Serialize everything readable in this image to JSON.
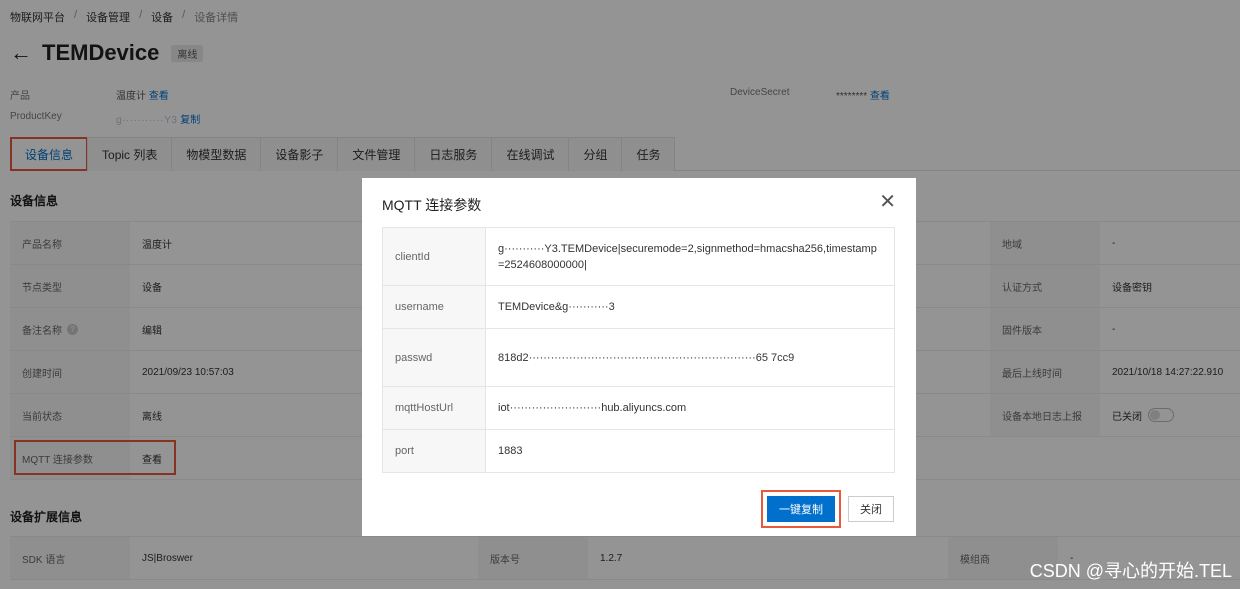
{
  "breadcrumb": [
    "物联网平台",
    "设备管理",
    "设备",
    "设备详情"
  ],
  "header": {
    "title": "TEMDevice",
    "status_badge": "离线"
  },
  "meta": {
    "product_label": "产品",
    "product_value": "温度计",
    "product_link": "查看",
    "productkey_label": "ProductKey",
    "productkey_value": "g···········Y3",
    "productkey_link": "复制",
    "secret_label": "DeviceSecret",
    "secret_value": "********",
    "secret_link": "查看"
  },
  "tabs": [
    "设备信息",
    "Topic 列表",
    "物模型数据",
    "设备影子",
    "文件管理",
    "日志服务",
    "在线调试",
    "分组",
    "任务"
  ],
  "info_section": {
    "title": "设备信息",
    "rows": [
      {
        "label": "产品名称",
        "value": "温度计",
        "label2": "地域",
        "value2": "-"
      },
      {
        "label": "节点类型",
        "value": "设备",
        "label2": "认证方式",
        "value2": "设备密钥"
      },
      {
        "label": "备注名称",
        "value": "编辑",
        "label2": "固件版本",
        "value2": "-"
      },
      {
        "label": "创建时间",
        "value": "2021/09/23 10:57:03",
        "label2": "最后上线时间",
        "value2": "2021/10/18 14:27:22.910"
      },
      {
        "label": "当前状态",
        "value": "离线",
        "label2": "设备本地日志上报",
        "value2": "已关闭"
      },
      {
        "label": "MQTT 连接参数",
        "value": "查看"
      }
    ]
  },
  "ext_section": {
    "title": "设备扩展信息",
    "row": {
      "label": "SDK 语言",
      "value": "JS|Broswer",
      "label_mid": "版本号",
      "value_mid": "1.2.7",
      "label2": "模组商",
      "value2": "-"
    }
  },
  "modal": {
    "title": "MQTT 连接参数",
    "params": [
      {
        "name": "clientId",
        "value": "g···········Y3.TEMDevice|securemode=2,signmethod=hmacsha256,timestamp=2524608000000|"
      },
      {
        "name": "username",
        "value": "TEMDevice&g···········3"
      },
      {
        "name": "passwd",
        "value": "818d2······························································65 7cc9"
      },
      {
        "name": "mqttHostUrl",
        "value": "iot·························hub.aliyuncs.com"
      },
      {
        "name": "port",
        "value": "1883"
      }
    ],
    "copy_button": "一键复制",
    "close_button": "关闭"
  },
  "watermark": "CSDN @寻心的开始.TEL",
  "colors": {
    "accent": "#0070cc",
    "highlight": "#e8593c"
  }
}
